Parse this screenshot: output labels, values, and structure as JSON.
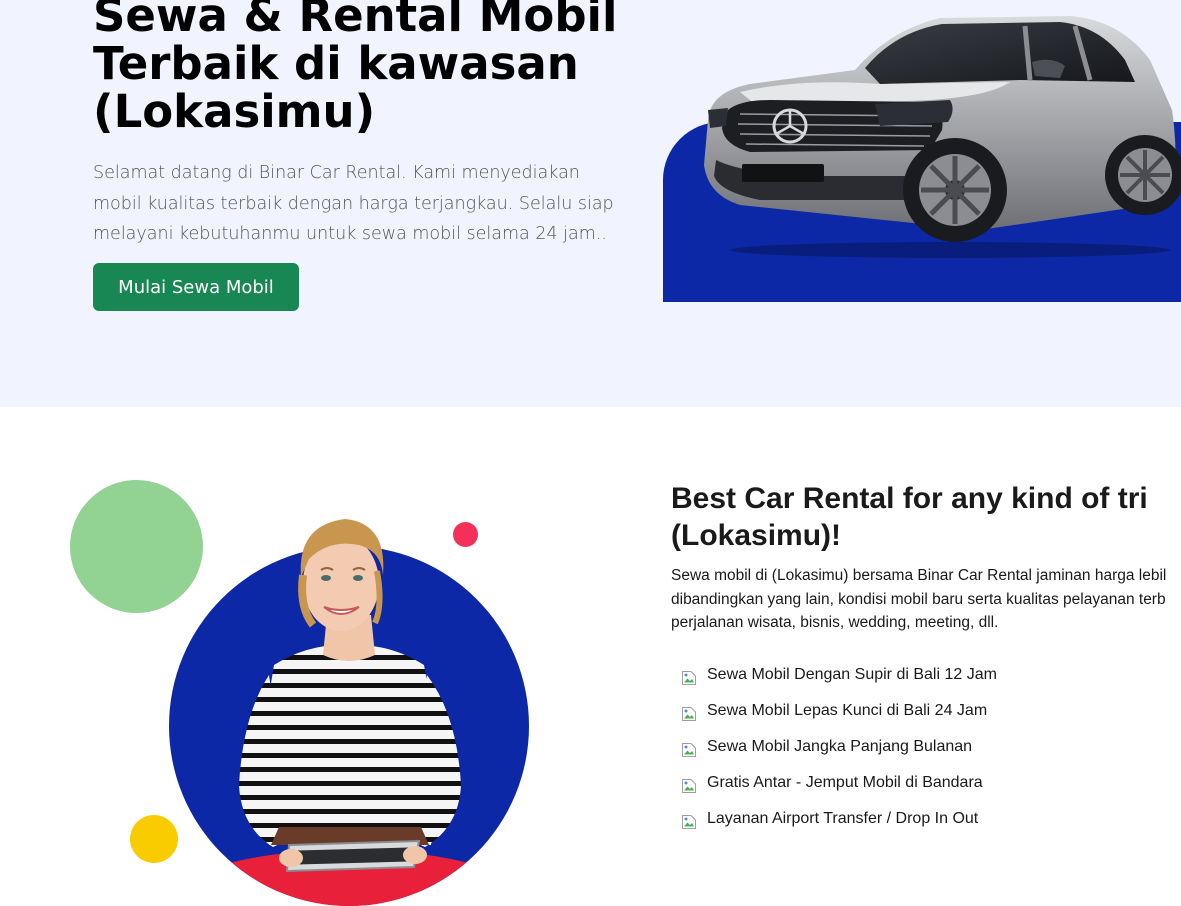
{
  "hero": {
    "title": "Sewa & Rental Mobil Terbaik di kawasan (Lokasimu)",
    "description": "Selamat datang di Binar Car Rental. Kami menyediakan mobil kualitas terbaik dengan harga terjangkau. Selalu siap melayani kebutuhanmu untuk sewa mobil selama 24 jam..",
    "cta_label": "Mulai Sewa Mobil"
  },
  "about": {
    "title_line1": "Best Car Rental for any kind of tri",
    "title_line2": "(Lokasimu)!",
    "desc_line1": "Sewa mobil di (Lokasimu) bersama Binar Car Rental jaminan harga lebil",
    "desc_line2": "dibandingkan yang lain, kondisi mobil baru serta kualitas pelayanan terb",
    "desc_line3": "perjalanan wisata, bisnis, wedding, meeting, dll.",
    "features": [
      "Sewa Mobil Dengan Supir di Bali 12 Jam",
      "Sewa Mobil Lepas Kunci di Bali 24 Jam",
      "Sewa Mobil Jangka Panjang Bulanan",
      "Gratis Antar - Jemput Mobil di Bandara",
      "Layanan Airport Transfer / Drop In Out"
    ]
  },
  "colors": {
    "hero_bg": "#f1f3fe",
    "brand_blue": "#0d28a6",
    "cta_green": "#198754",
    "decor_green": "#92d293",
    "decor_red": "#f4305a",
    "decor_yellow": "#f9cc00"
  },
  "icons": {
    "feature_bullet": "broken-image-icon",
    "car": "car-image",
    "person": "woman-with-tablet-image"
  }
}
